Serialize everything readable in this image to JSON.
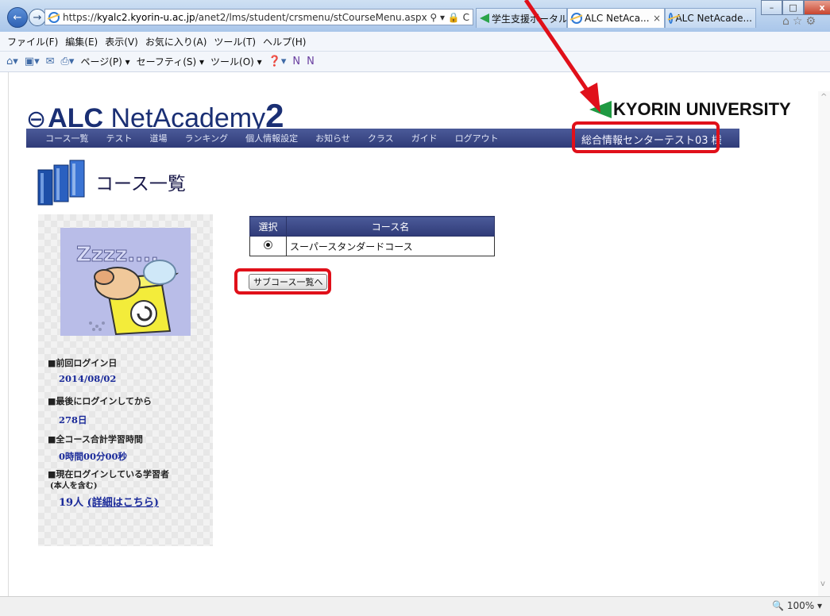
{
  "browser": {
    "url_prefix": "https://",
    "url_host": "kyalc2.kyorin-u.ac.jp",
    "url_path": "/anet2/lms/student/crsmenu/stCourseMenu.aspx",
    "addr_tools": "⚲ ▾ 🔒 C",
    "tabs": [
      {
        "label": "学生支援ポータル"
      },
      {
        "label": "ALC NetAca... ",
        "close": "×"
      },
      {
        "label": "ALC NetAcade..."
      }
    ],
    "window_controls": {
      "minimize": "–",
      "maximize": "□",
      "close": "x"
    },
    "right_icons": [
      "⌂",
      "☆",
      "⚙"
    ],
    "menu": [
      "ファイル(F)",
      "編集(E)",
      "表示(V)",
      "お気に入り(A)",
      "ツール(T)",
      "ヘルプ(H)"
    ],
    "commands": [
      "ページ(P) ▾",
      "セーフティ(S) ▾",
      "ツール(O) ▾"
    ],
    "zoom": "🔍 100%  ▾"
  },
  "site": {
    "logo_alc": "ALC",
    "logo_net": " NetAcademy",
    "logo_version": "2",
    "university": "KYORIN UNIVERSITY",
    "user_name": "総合情報センターテスト03 様"
  },
  "nav": [
    "コース一覧",
    "テスト",
    "道場",
    "ランキング",
    "個人情報設定",
    "お知らせ",
    "クラス",
    "ガイド",
    "ログアウト"
  ],
  "page": {
    "title": "コース一覧",
    "table_headers": [
      "選択",
      "コース名"
    ],
    "courses": [
      {
        "name": "スーパースタンダードコース",
        "selected": true
      }
    ],
    "subcourse_button": "サブコース一覧へ"
  },
  "sidebar": {
    "mascot_text": "Zzzz....",
    "last_login_label": "■前回ログイン日",
    "last_login_value": "2014/08/02",
    "since_label": "■最後にログインしてから",
    "since_value": "278日",
    "total_time_label": "■全コース合計学習時間",
    "total_time_value": "0時間00分00秒",
    "online_label": "■現在ログインしている学習者",
    "online_sub": "(本人を含む)",
    "online_value": "19人",
    "detail_link": "(詳細はこちら)"
  },
  "colors": {
    "nav_bg": "#3a4687",
    "highlight": "#e0101a",
    "title_blue": "#1a2f74",
    "kyorin_green": "#1f9a42"
  }
}
